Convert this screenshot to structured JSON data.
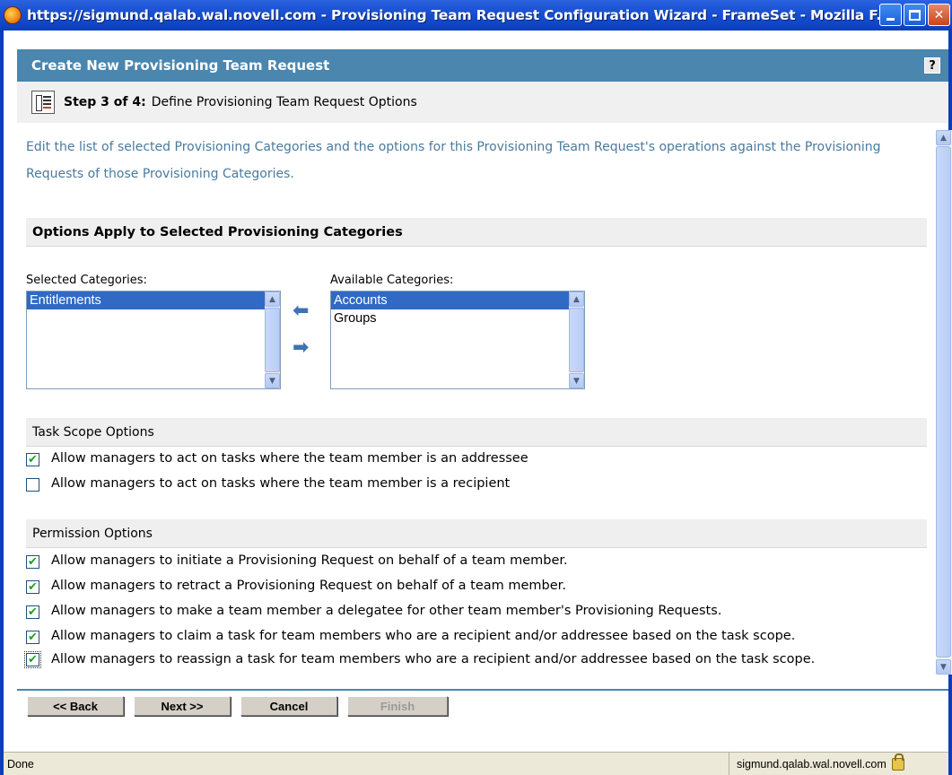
{
  "window": {
    "title": "https://sigmund.qalab.wal.novell.com - Provisioning Team Request Configuration Wizard - FrameSet - Mozilla F..."
  },
  "header": {
    "title": "Create New Provisioning Team Request",
    "help_label": "?"
  },
  "step": {
    "label": "Step 3 of 4:",
    "title": "Define Provisioning Team Request Options"
  },
  "intro": "Edit the list of selected Provisioning Categories and the options for this Provisioning Team Request's operations against the Provisioning Requests of those Provisioning Categories.",
  "categories_section": {
    "heading": "Options Apply to Selected Provisioning Categories",
    "selected_label": "Selected Categories:",
    "available_label": "Available Categories:",
    "selected_items": [
      "Entitlements"
    ],
    "available_items": [
      "Accounts",
      "Groups"
    ]
  },
  "task_scope": {
    "heading": "Task Scope Options",
    "options": [
      {
        "label": "Allow managers to act on tasks where the team member is an addressee",
        "checked": true
      },
      {
        "label": "Allow managers to act on tasks where the team member is a recipient",
        "checked": false
      }
    ]
  },
  "permissions": {
    "heading": "Permission Options",
    "options": [
      {
        "label": "Allow managers to initiate a Provisioning Request on behalf of a team member.",
        "checked": true
      },
      {
        "label": "Allow managers to retract a Provisioning Request on behalf of a team member.",
        "checked": true
      },
      {
        "label": "Allow managers to make a team member a delegatee for other team member's Provisioning Requests.",
        "checked": true
      },
      {
        "label": "Allow managers to claim a task for team members who are a recipient and/or addressee based on the task scope.",
        "checked": true
      },
      {
        "label": "Allow managers to reassign a task for team members who are a recipient and/or addressee based on the task scope.",
        "checked": true
      }
    ]
  },
  "buttons": {
    "back": "<< Back",
    "next": "Next >>",
    "cancel": "Cancel",
    "finish": "Finish"
  },
  "status": {
    "text": "Done",
    "host": "sigmund.qalab.wal.novell.com"
  }
}
